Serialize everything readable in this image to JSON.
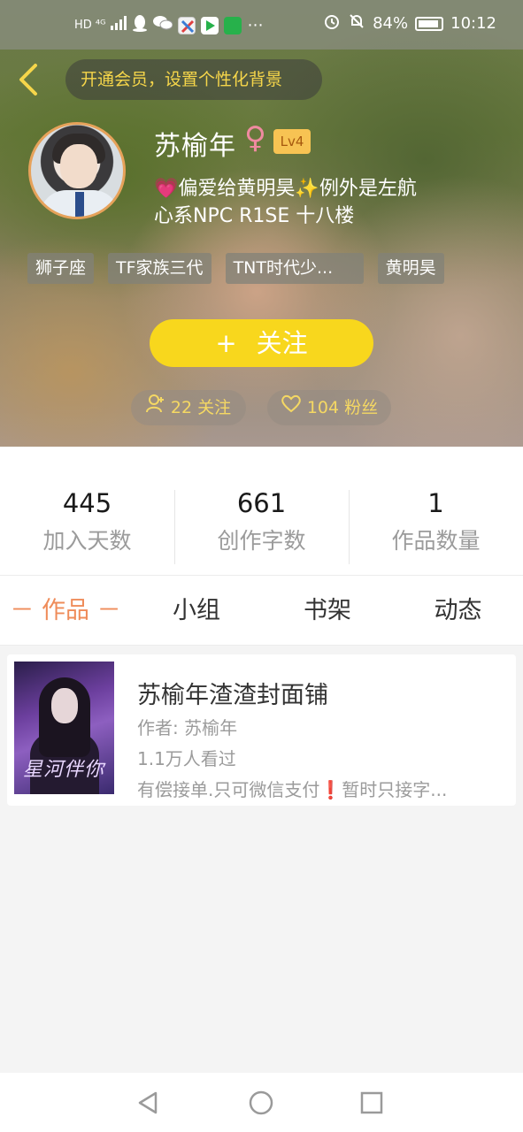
{
  "status_bar": {
    "left_text": "HD ⁴ᴳ",
    "battery": "84%",
    "time": "10:12"
  },
  "header": {
    "vip_banner": "开通会员，设置个性化背景"
  },
  "profile": {
    "nickname": "苏榆年",
    "gender_symbol": "♀",
    "level": "Lv4",
    "bio_part1": "偏爱给黄明昊",
    "bio_part2": "例外是左航",
    "bio_line2": "心系NPC R1SE 十八楼",
    "tags": [
      "狮子座",
      "TF家族三代",
      "TNT时代少...",
      "黄明昊"
    ],
    "follow_button": "关注",
    "following": "22 关注",
    "fans": "104 粉丝"
  },
  "stats": [
    {
      "value": "445",
      "label": "加入天数"
    },
    {
      "value": "661",
      "label": "创作字数"
    },
    {
      "value": "1",
      "label": "作品数量"
    }
  ],
  "tabs": [
    "－ 作品 －",
    "小组",
    "书架",
    "动态"
  ],
  "works": [
    {
      "title": "苏榆年渣渣封面铺",
      "author": "作者: 苏榆年",
      "views": "1.1万人看过",
      "desc_part1": "有偿接单.只可微信支付",
      "desc_part2": "暂时只接字...",
      "cover_text": "星河伴你"
    }
  ],
  "colors": {
    "accent_yellow": "#f8d71d",
    "tab_active": "#ef8c5a",
    "level_badge": "#f7c353"
  }
}
